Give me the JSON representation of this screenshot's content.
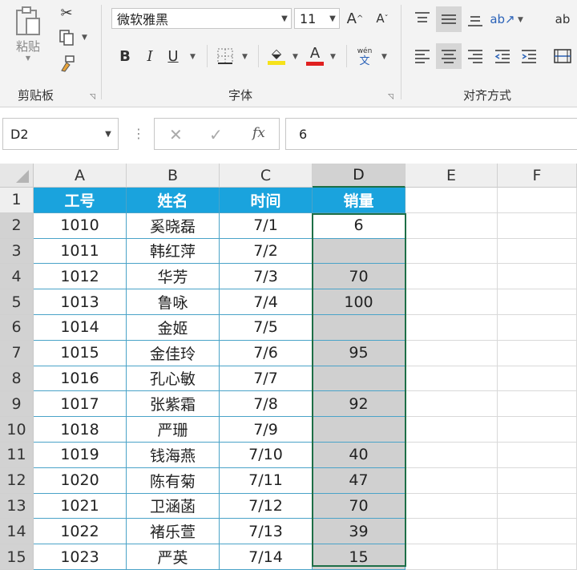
{
  "ribbon": {
    "clipboard": {
      "paste_label": "粘贴",
      "group_label": "剪贴板"
    },
    "font": {
      "font_name": "微软雅黑",
      "font_size": "11",
      "bold": "B",
      "italic": "I",
      "underline": "U",
      "fill_letter": "A",
      "font_color_letter": "A",
      "phonetic_top": "wén",
      "phonetic_bottom": "文",
      "grow": "A",
      "shrink": "A",
      "group_label": "字体",
      "fill_color": "#f6e21a",
      "font_color": "#e02020"
    },
    "alignment": {
      "group_label": "对齐方式",
      "wrap_label": "ab"
    }
  },
  "formula_bar": {
    "name_box": "D2",
    "formula": "6",
    "fx_label": "fx"
  },
  "columns": [
    "A",
    "B",
    "C",
    "D",
    "E",
    "F"
  ],
  "selected_column": "D",
  "rows": [
    {
      "num": "1",
      "cells": [
        "工号",
        "姓名",
        "时间",
        "销量"
      ]
    },
    {
      "num": "2",
      "cells": [
        "1010",
        "奚晓磊",
        "7/1",
        "6"
      ]
    },
    {
      "num": "3",
      "cells": [
        "1011",
        "韩红萍",
        "7/2",
        ""
      ]
    },
    {
      "num": "4",
      "cells": [
        "1012",
        "华芳",
        "7/3",
        "70"
      ]
    },
    {
      "num": "5",
      "cells": [
        "1013",
        "鲁咏",
        "7/4",
        "100"
      ]
    },
    {
      "num": "6",
      "cells": [
        "1014",
        "金姬",
        "7/5",
        ""
      ]
    },
    {
      "num": "7",
      "cells": [
        "1015",
        "金佳玲",
        "7/6",
        "95"
      ]
    },
    {
      "num": "8",
      "cells": [
        "1016",
        "孔心敏",
        "7/7",
        ""
      ]
    },
    {
      "num": "9",
      "cells": [
        "1017",
        "张紫霜",
        "7/8",
        "92"
      ]
    },
    {
      "num": "10",
      "cells": [
        "1018",
        "严珊",
        "7/9",
        ""
      ]
    },
    {
      "num": "11",
      "cells": [
        "1019",
        "钱海燕",
        "7/10",
        "40"
      ]
    },
    {
      "num": "12",
      "cells": [
        "1020",
        "陈有菊",
        "7/11",
        "47"
      ]
    },
    {
      "num": "13",
      "cells": [
        "1021",
        "卫涵菡",
        "7/12",
        "70"
      ]
    },
    {
      "num": "14",
      "cells": [
        "1022",
        "褚乐萱",
        "7/13",
        "39"
      ]
    },
    {
      "num": "15",
      "cells": [
        "1023",
        "严英",
        "7/14",
        "15"
      ]
    }
  ],
  "colors": {
    "header_fill": "#1aa3dd",
    "selection_border": "#1e6f47",
    "selected_fill": "#d0d0d0"
  }
}
